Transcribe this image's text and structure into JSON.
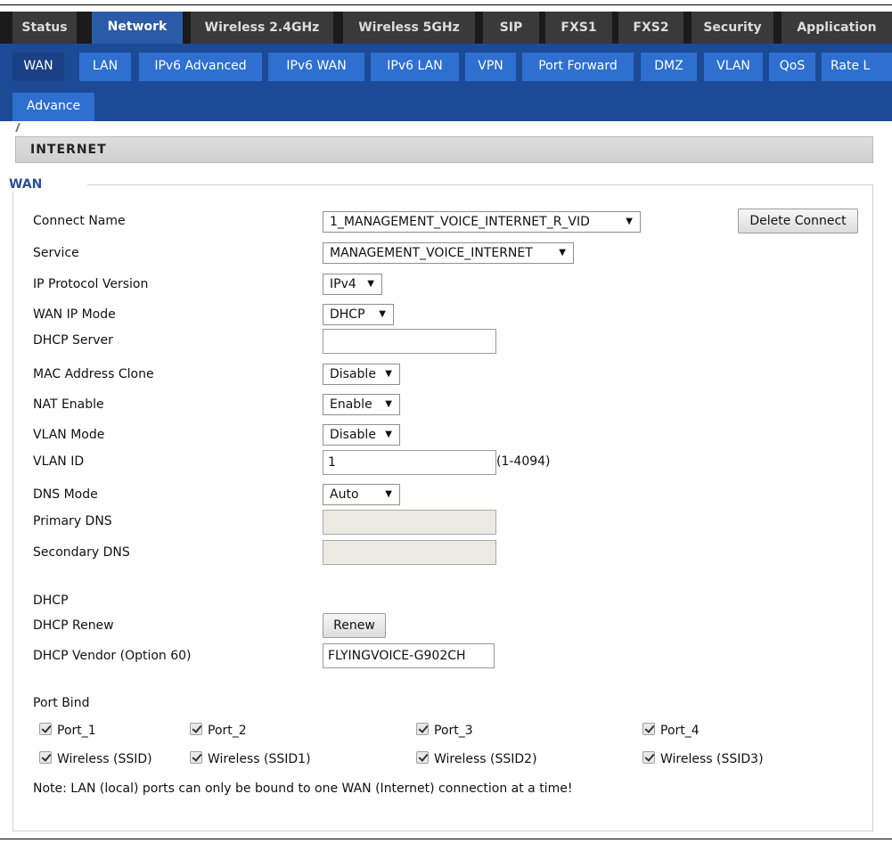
{
  "main_nav": [
    "Status",
    "Network",
    "Wireless 2.4GHz",
    "Wireless 5GHz",
    "SIP",
    "FXS1",
    "FXS2",
    "Security",
    "Application"
  ],
  "sub_nav": [
    "WAN",
    "LAN",
    "IPv6 Advanced",
    "IPv6 WAN",
    "IPv6 LAN",
    "VPN",
    "Port Forward",
    "DMZ",
    "VLAN",
    "QoS",
    "Rate L",
    "Advance"
  ],
  "section_title": "INTERNET",
  "fieldset_legend": "WAN",
  "fields": {
    "connect_name": {
      "label": "Connect Name",
      "value": "1_MANAGEMENT_VOICE_INTERNET_R_VID"
    },
    "delete_button": "Delete Connect",
    "service": {
      "label": "Service",
      "value": "MANAGEMENT_VOICE_INTERNET"
    },
    "ip_protocol": {
      "label": "IP Protocol Version",
      "value": "IPv4"
    },
    "wan_ip_mode": {
      "label": "WAN IP Mode",
      "value": "DHCP"
    },
    "dhcp_server": {
      "label": "DHCP Server",
      "value": ""
    },
    "mac_clone": {
      "label": "MAC Address Clone",
      "value": "Disable"
    },
    "nat_enable": {
      "label": "NAT Enable",
      "value": "Enable"
    },
    "vlan_mode": {
      "label": "VLAN Mode",
      "value": "Disable"
    },
    "vlan_id": {
      "label": "VLAN ID",
      "value": "1",
      "hint": "(1-4094)"
    },
    "dns_mode": {
      "label": "DNS Mode",
      "value": "Auto"
    },
    "primary_dns": {
      "label": "Primary DNS",
      "value": ""
    },
    "secondary_dns": {
      "label": "Secondary DNS",
      "value": ""
    }
  },
  "dhcp": {
    "heading": "DHCP",
    "renew_label": "DHCP Renew",
    "renew_button": "Renew",
    "vendor_label": "DHCP Vendor (Option 60)",
    "vendor_value": "FLYINGVOICE-G902CH"
  },
  "port_bind": {
    "heading": "Port Bind",
    "ports": [
      {
        "label": "Port_1",
        "checked": true
      },
      {
        "label": "Port_2",
        "checked": true
      },
      {
        "label": "Port_3",
        "checked": true
      },
      {
        "label": "Port_4",
        "checked": true
      },
      {
        "label": "Wireless (SSID)",
        "checked": true
      },
      {
        "label": "Wireless (SSID1)",
        "checked": true
      },
      {
        "label": "Wireless (SSID2)",
        "checked": true
      },
      {
        "label": "Wireless (SSID3)",
        "checked": true
      }
    ],
    "note": "Note: LAN (local) ports can only be bound to one WAN (Internet) connection at a time!"
  }
}
